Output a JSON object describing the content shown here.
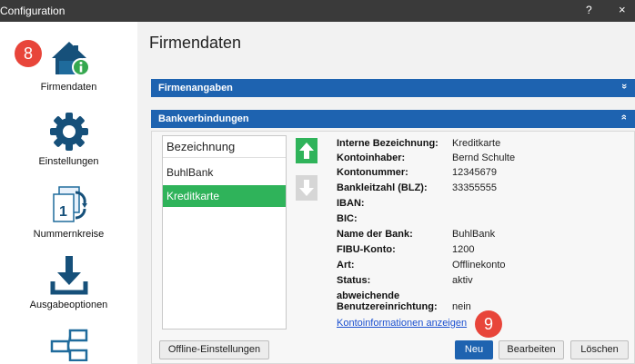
{
  "window": {
    "title": "Configuration",
    "help_label": "?",
    "close_label": "×"
  },
  "sidebar": {
    "items": [
      {
        "label": "Firmendaten",
        "icon": "home-info-icon"
      },
      {
        "label": "Einstellungen",
        "icon": "gear-icon"
      },
      {
        "label": "Nummernkreise",
        "icon": "numbering-icon"
      },
      {
        "label": "Ausgabeoptionen",
        "icon": "download-icon"
      },
      {
        "label": "",
        "icon": "structure-icon"
      }
    ],
    "badge": "8"
  },
  "main": {
    "page_title": "Firmendaten",
    "sections": [
      {
        "title": "Firmenangaben",
        "chevron": "»"
      },
      {
        "title": "Bankverbindungen",
        "chevron": "»"
      }
    ],
    "list": {
      "header": "Bezeichnung",
      "rows": [
        "BuhlBank",
        "Kreditkarte"
      ],
      "selected": "Kreditkarte"
    },
    "details": [
      {
        "label": "Interne Bezeichnung:",
        "value": "Kreditkarte"
      },
      {
        "label": "Kontoinhaber:",
        "value": "Bernd Schulte"
      },
      {
        "label": "Kontonummer:",
        "value": "12345679"
      },
      {
        "label": "Bankleitzahl (BLZ):",
        "value": "33355555"
      },
      {
        "label": "IBAN:",
        "value": ""
      },
      {
        "label": "BIC:",
        "value": ""
      },
      {
        "label": "Name der Bank:",
        "value": "BuhlBank"
      },
      {
        "label": "FIBU-Konto:",
        "value": "1200"
      },
      {
        "label": "Art:",
        "value": "Offlinekonto"
      },
      {
        "label": "Status:",
        "value": "aktiv"
      },
      {
        "label": "abweichende",
        "value": ""
      },
      {
        "label": "Benutzereinrichtung:",
        "value": "nein"
      }
    ],
    "link": "Kontoinformationen anzeigen",
    "buttons": {
      "offline": "Offline-Einstellungen",
      "new": "Neu",
      "edit": "Bearbeiten",
      "delete": "Löschen"
    },
    "badge": "9"
  },
  "colors": {
    "titlebar": "#3a3a3a",
    "section_bar": "#1e63b0",
    "selected_row": "#2fb35a",
    "badge": "#e8453a",
    "link": "#1a4fd0"
  }
}
